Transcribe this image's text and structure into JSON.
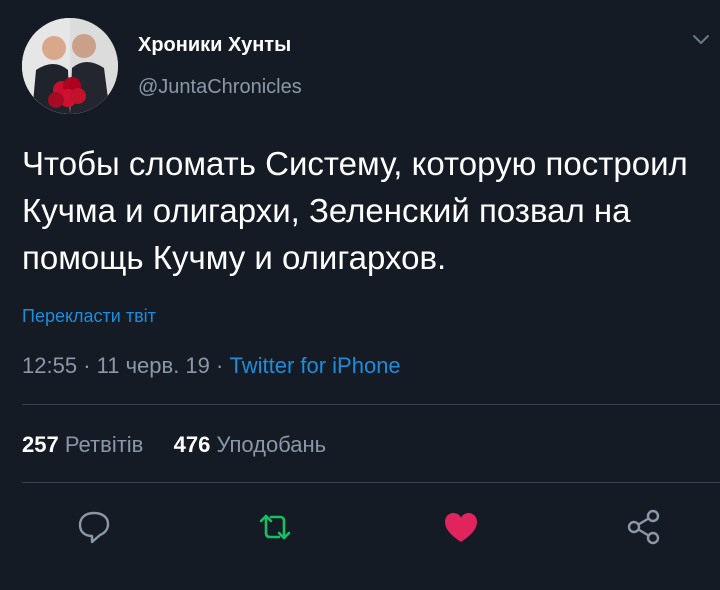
{
  "user": {
    "display_name": "Хроники Хунты",
    "handle": "@JuntaChronicles"
  },
  "tweet": {
    "text": "Чтобы сломать Систему, которую построил Кучма и олигархи, Зеленский позвал на помощь Кучму и олигархов.",
    "translate_label": "Перекласти твіт",
    "time": "12:55",
    "separator": "·",
    "date": "11 черв. 19",
    "source": "Twitter for iPhone"
  },
  "stats": {
    "retweets_count": "257",
    "retweets_label": "Ретвітів",
    "likes_count": "476",
    "likes_label": "Уподобань"
  },
  "icons": {
    "reply": "reply-icon",
    "retweet": "retweet-icon",
    "like": "heart-icon",
    "share": "share-icon",
    "menu": "chevron-down-icon"
  },
  "colors": {
    "background": "#151b25",
    "link": "#1d8ddb",
    "retweet": "#17bf63",
    "like": "#e0245e",
    "muted": "#8a98a8"
  }
}
